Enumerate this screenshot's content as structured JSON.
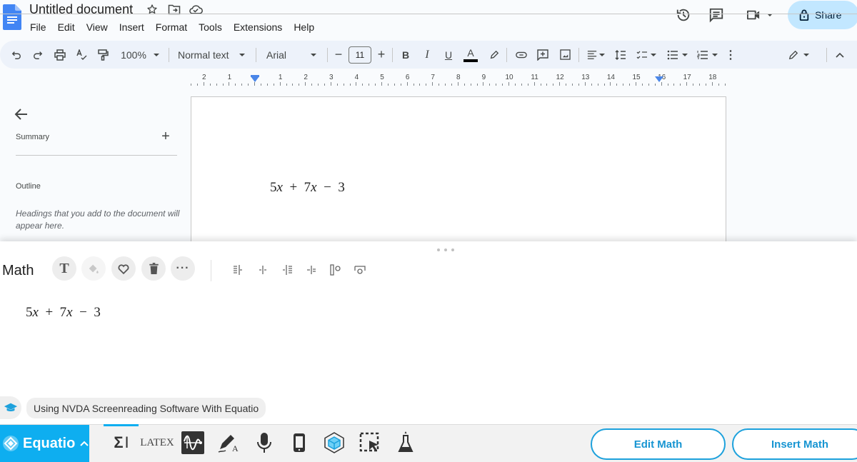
{
  "app": {
    "doc_title": "Untitled document",
    "menu": [
      "File",
      "Edit",
      "View",
      "Insert",
      "Format",
      "Tools",
      "Extensions",
      "Help"
    ],
    "share_label": "Share",
    "colors": {
      "share_bg": "#c2e7ff",
      "docs_blue": "#4285f4",
      "equatio_blue": "#0eaef0",
      "toolbar_bg": "#edf2fa"
    }
  },
  "toolbar": {
    "zoom": "100%",
    "style": "Normal text",
    "font": "Arial",
    "font_size": "11",
    "bold": "B",
    "italic": "I",
    "underline": "U",
    "text_color": "A"
  },
  "ruler": {
    "labels": [
      "2",
      "1",
      "1",
      "2",
      "3",
      "4",
      "5",
      "6",
      "7",
      "8",
      "9",
      "10",
      "11",
      "12",
      "13",
      "14",
      "15",
      "16",
      "17",
      "18"
    ]
  },
  "sidebar": {
    "summary_label": "Summary",
    "outline_label": "Outline",
    "outline_hint": "Headings that you add to the document will appear here."
  },
  "document": {
    "math_text": "5x + 7x − 3"
  },
  "equatio": {
    "panel_title": "Math",
    "math_text": "5x + 7x − 3",
    "tutorial_link": "Using NVDA Screenreading Software With Equatio",
    "brand": "Equatio",
    "latex_tool": "LATEX",
    "edit_math": "Edit Math",
    "insert_math": "Insert Math"
  }
}
